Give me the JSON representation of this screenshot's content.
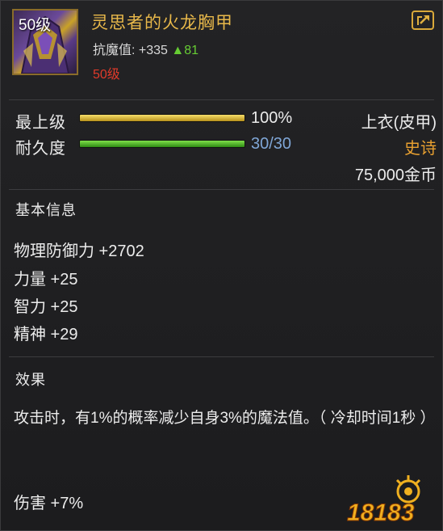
{
  "item": {
    "icon_level": "50级",
    "name": "灵思者的火龙胸甲",
    "resist_label": "抗魔值:",
    "resist_value": "+335",
    "resist_gain": "▲81",
    "required_level": "50级",
    "icon": "chest-armor-icon",
    "share_icon": "share-icon"
  },
  "stats": {
    "upgrade_label": "最上级",
    "upgrade_percent": 100,
    "upgrade_text": "100%",
    "durability_label": "耐久度",
    "durability_current": 30,
    "durability_max": 30,
    "durability_text": "30/30",
    "slot_type": "上衣(皮甲)",
    "rarity": "史诗",
    "price": "75,000金币"
  },
  "basic_info": {
    "title": "基本信息",
    "attributes": [
      "物理防御力 +2702",
      "力量 +25",
      "智力 +25",
      "精神 +29"
    ]
  },
  "effect": {
    "title": "效果",
    "description": "攻击时，有1%的概率减少自身3%的魔法值。（ 冷却时间1秒 ）",
    "damage": "伤害 +7%"
  },
  "watermark": {
    "text": "18183"
  },
  "colors": {
    "item_name": "#e8b84a",
    "required_level": "#e03a2a",
    "rarity": "#e8a030",
    "durability_text": "#7fa6d6",
    "resist_gain": "#66cc33"
  }
}
